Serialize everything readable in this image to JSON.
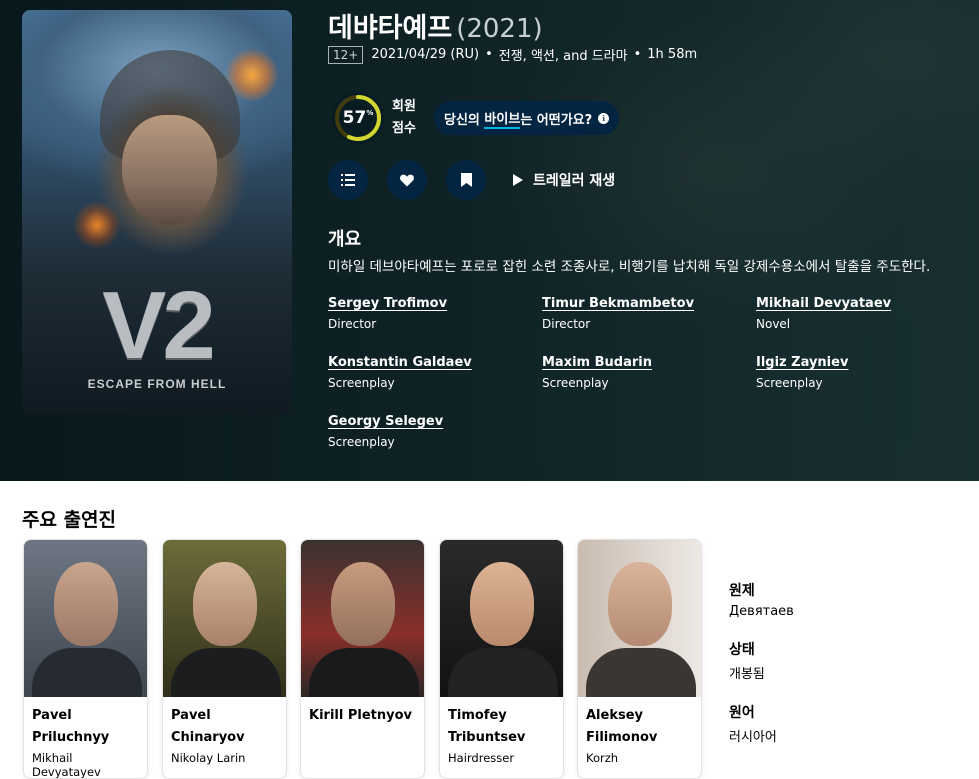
{
  "movie": {
    "title": "데뱌타예프",
    "year": "(2021)",
    "certification": "12+",
    "release": "2021/04/29 (RU)",
    "genres": "전쟁, 액션, and 드라마",
    "runtime": "1h 58m",
    "poster_title": "V2",
    "poster_subtitle": "ESCAPE FROM HELL"
  },
  "score": {
    "value": "57",
    "percent_sign": "%",
    "label_line1": "회원",
    "label_line2": "점수",
    "fraction": 0.57,
    "ring_color": "#d2d531"
  },
  "vibe": {
    "pre": "당신의 ",
    "highlight": "바이브",
    "post": "는 어떤가요?",
    "info": "i"
  },
  "actions": {
    "trailer_label": "트레일러 재생"
  },
  "overview": {
    "heading": "개요",
    "text": "미하일 데브야타예프는 포로로 잡힌 소련 조종사로, 비행기를 납치해 독일 강제수용소에서 탈출을 주도한다."
  },
  "crew": [
    {
      "name": "Sergey Trofimov",
      "job": "Director"
    },
    {
      "name": "Timur Bekmambetov",
      "job": "Director"
    },
    {
      "name": "Mikhail Devyataev",
      "job": "Novel"
    },
    {
      "name": "Konstantin Galdaev",
      "job": "Screenplay"
    },
    {
      "name": "Maxim Budarin",
      "job": "Screenplay"
    },
    {
      "name": "Ilgiz Zayniev",
      "job": "Screenplay"
    },
    {
      "name": "Georgy Selegev",
      "job": "Screenplay"
    }
  ],
  "cast_heading": "주요 출연진",
  "cast": [
    {
      "name": "Pavel Priluchnyy",
      "role": "Mikhail Devyatayev"
    },
    {
      "name": "Pavel Chinaryov",
      "role": "Nikolay Larin"
    },
    {
      "name": "Kirill Pletnyov",
      "role": ""
    },
    {
      "name": "Timofey Tribuntsev",
      "role": "Hairdresser"
    },
    {
      "name": "Aleksey Filimonov",
      "role": "Korzh"
    }
  ],
  "facts": [
    {
      "label": "원제",
      "value": "Девятаев"
    },
    {
      "label": "상태",
      "value": "개봉됨"
    },
    {
      "label": "원어",
      "value": "러시아어"
    }
  ]
}
